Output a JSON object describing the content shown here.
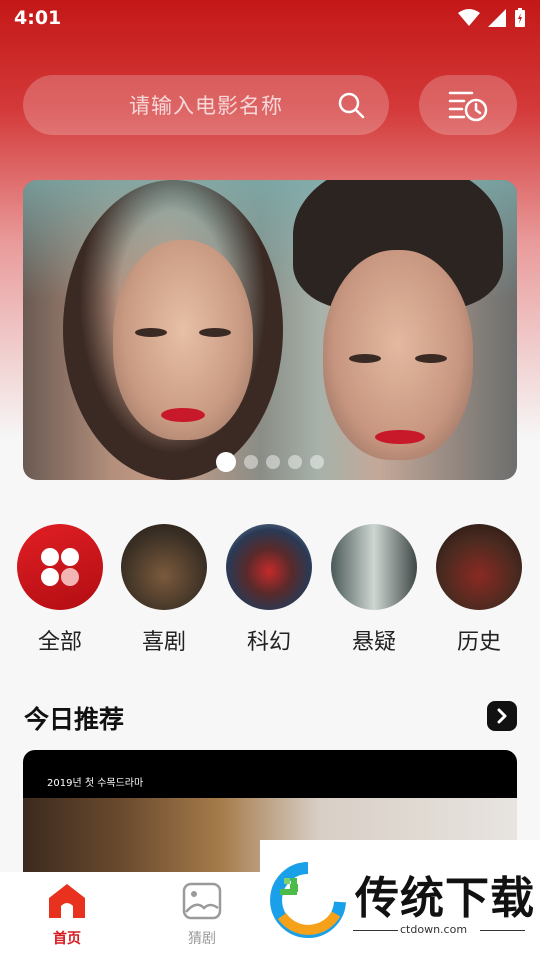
{
  "status_bar": {
    "time": "4:01"
  },
  "search": {
    "placeholder": "请输入电影名称"
  },
  "icons": {
    "search": "search-icon",
    "history": "history-clock-icon",
    "all": "four-leaf-grid-icon",
    "more": "chevron-right-icon",
    "home": "home-icon",
    "guess": "image-icon"
  },
  "banner": {
    "slide_count": 5,
    "active_slide": 1
  },
  "categories": [
    {
      "label": "全部"
    },
    {
      "label": "喜剧"
    },
    {
      "label": "科幻"
    },
    {
      "label": "悬疑"
    },
    {
      "label": "历史"
    }
  ],
  "recommend": {
    "title": "今日推荐",
    "card_caption": "2019년 첫 수목드라마"
  },
  "nav": {
    "home_label": "首页",
    "guess_label": "猜剧"
  },
  "watermark": {
    "text": "传统下载",
    "sub": "ctdown.com"
  },
  "colors": {
    "brand_red": "#c41717",
    "active_nav": "#d8181f",
    "inactive_nav": "#9a9a9a"
  }
}
